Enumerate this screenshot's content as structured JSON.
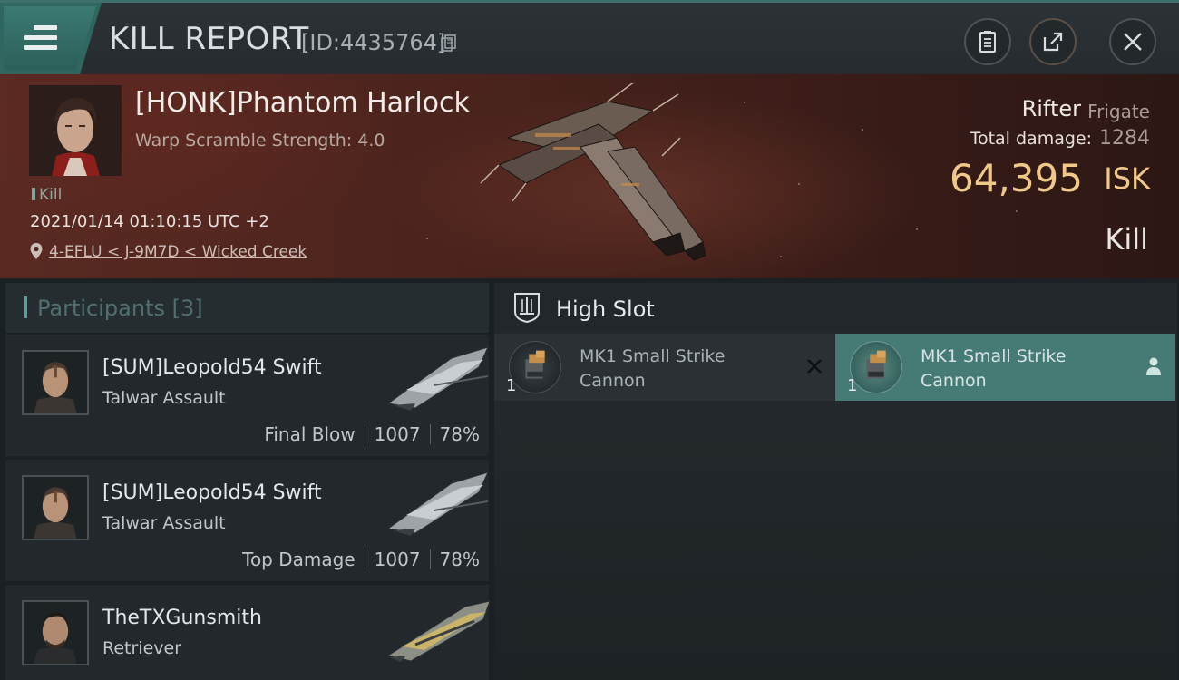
{
  "header": {
    "title": "KILL REPORT",
    "report_id": "[ID:4435764]"
  },
  "victim": {
    "name": "[HONK]Phantom Harlock",
    "warp_scramble": "Warp Scramble Strength: 4.0",
    "kill_tag": "Kill",
    "datetime": "2021/01/14 01:10:15 UTC +2",
    "location": "4-EFLU < J-9M7D < Wicked Creek",
    "ship_name": "Rifter",
    "ship_class": "Frigate",
    "total_damage_label": "Total damage:",
    "total_damage": "1284",
    "isk_value": "64,395",
    "isk_unit": "ISK",
    "result": "Kill"
  },
  "participants": {
    "title": "Participants [3]",
    "items": [
      {
        "name": "[SUM]Leopold54 Swift",
        "ship": "Talwar Assault",
        "tag": "Final Blow",
        "damage": "1007",
        "percent": "78%"
      },
      {
        "name": "[SUM]Leopold54 Swift",
        "ship": "Talwar Assault",
        "tag": "Top Damage",
        "damage": "1007",
        "percent": "78%"
      },
      {
        "name": "TheTXGunsmith",
        "ship": "Retriever",
        "tag": "",
        "damage": "",
        "percent": ""
      }
    ]
  },
  "high_slot": {
    "title": "High Slot",
    "modules": [
      {
        "qty": "1",
        "name": "MK1 Small Strike Cannon",
        "status": "destroyed"
      },
      {
        "qty": "1",
        "name": "MK1 Small Strike Cannon",
        "status": "dropped"
      }
    ]
  },
  "colors": {
    "accent_teal": "#467a74",
    "isk_gold": "#f0c989",
    "banner_red": "#5a2a22"
  },
  "icons": [
    "menu-icon",
    "copy-icon",
    "clipboard-icon",
    "share-icon",
    "close-icon",
    "location-pin-icon",
    "high-slot-icon",
    "destroyed-x-icon",
    "person-icon"
  ]
}
